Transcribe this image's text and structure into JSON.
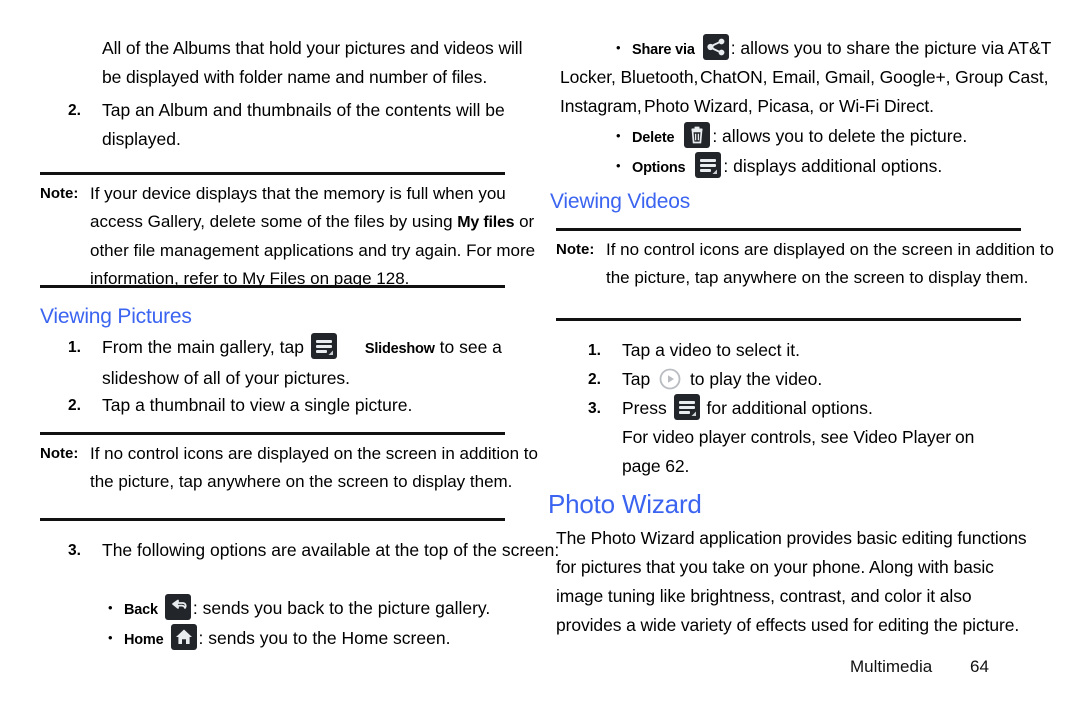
{
  "document": {
    "footer": {
      "section": "Multimedia",
      "page_number": "64"
    }
  },
  "left_column": {
    "intro_paragraph": "All of the Albums that hold your pictures and videos will be displayed with folder name and number of files.",
    "step2": {
      "num": "2.",
      "text": "Tap an Album and thumbnails of the contents will be displayed."
    },
    "note1": {
      "tag": "Note:",
      "text_part1": "If your device displays that the memory is full when you access Gallery, delete some of the files by using ",
      "bold_term": "My files",
      "text_part2": " or other file management applications and try again. For more information, refer to  My Files  on page 128."
    },
    "viewing_pictures": {
      "heading": "Viewing Pictures",
      "step1_num": "1.",
      "step1_text_a": "From the main gallery, tap ",
      "step1_icon_label": "Slideshow",
      "step1_text_b": " to see a slideshow of all of your pictures.",
      "step2_num": "2.",
      "step2_text": "Tap a thumbnail to view a single picture."
    },
    "note2": {
      "tag": "Note:",
      "text": "If no control icons are displayed on the screen in addition to the picture, tap anywhere on the screen to display them."
    },
    "step3": {
      "num": "3.",
      "text": "The following options are available at the top of the screen:",
      "bullets": [
        {
          "label": "Back",
          "icon": "back-icon",
          "text": ": sends you back to the picture gallery."
        },
        {
          "label": "Home",
          "icon": "home-icon",
          "text": ": sends you to the Home screen."
        }
      ]
    }
  },
  "right_column": {
    "bullets_top": [
      {
        "label": "Share via",
        "icon": "share-icon",
        "text_line1": ": allows you to share the picture via AT&T",
        "text_line2_a": "Locker, Bluetooth,",
        "text_line2_b": "ChatON, Email, Gmail, Google+, Group Cast,",
        "text_line3_a": "Instagram,",
        "text_line3_b": "Photo Wizard, Picasa, or Wi-Fi Direct."
      },
      {
        "label": "Delete",
        "icon": "trash-icon",
        "text": ": allows you to delete the picture."
      },
      {
        "label": "Options",
        "icon": "menu-icon",
        "text": ": displays additional options."
      }
    ],
    "viewing_videos": {
      "heading": "Viewing Videos",
      "note": {
        "tag": "Note:",
        "text": "If no control icons are displayed on the screen in addition to the picture, tap anywhere on the screen to display them."
      },
      "step1": {
        "num": "1.",
        "text": "Tap a video to select it."
      },
      "step2": {
        "num": "2.",
        "text_a": "Tap ",
        "icon": "play-icon",
        "text_b": " to play the video."
      },
      "step3": {
        "num": "3.",
        "text_a": "Press ",
        "icon": "menu-icon",
        "text_b": " for additional options.",
        "cross_ref_a": "For video player controls, see  Video Player",
        "cross_ref_b": "on",
        "cross_ref_c": "page 62."
      }
    },
    "photo_wizard": {
      "heading": "Photo Wizard",
      "body": "The Photo Wizard application provides basic editing functions for pictures that you take on your phone. Along with basic image tuning like brightness, contrast, and color it also provides a wide variety of effects used for editing the picture."
    }
  },
  "colors": {
    "heading_blue": "#3b64f0",
    "icon_dark": "#22262b",
    "rule_black": "#111111"
  }
}
